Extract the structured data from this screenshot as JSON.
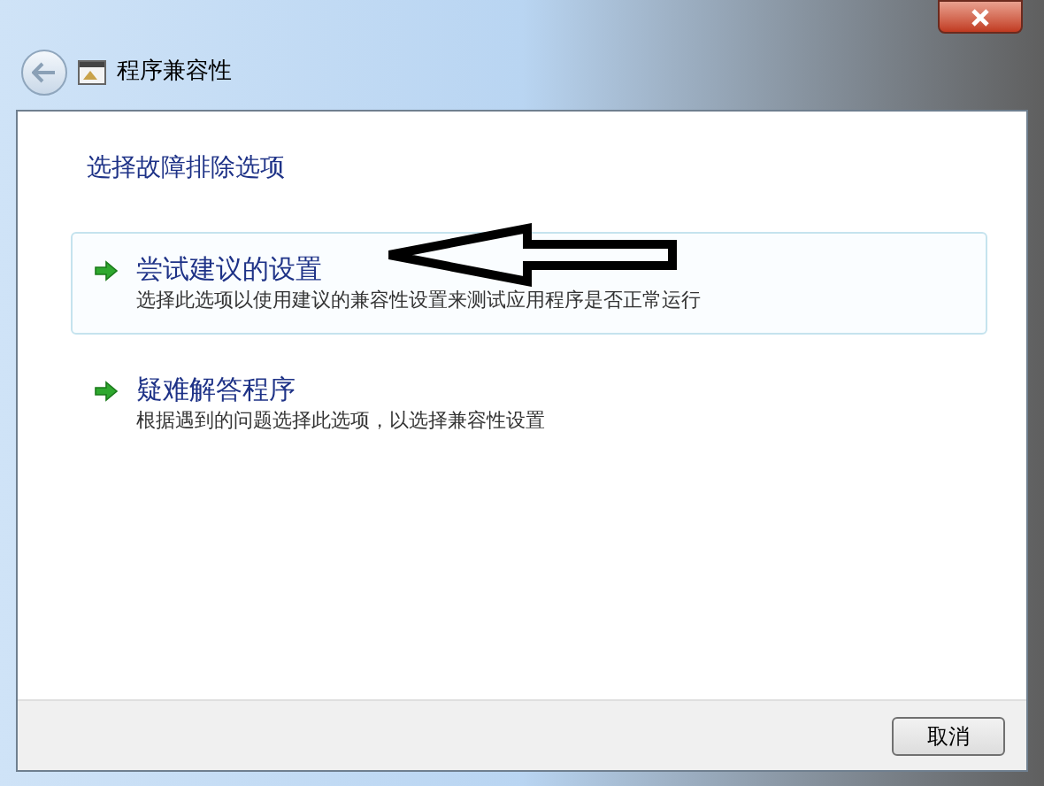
{
  "window": {
    "title": "程序兼容性"
  },
  "heading": "选择故障排除选项",
  "options": [
    {
      "title": "尝试建议的设置",
      "description": "选择此选项以使用建议的兼容性设置来测试应用程序是否正常运行",
      "selected": true
    },
    {
      "title": "疑难解答程序",
      "description": "根据遇到的问题选择此选项，以选择兼容性设置",
      "selected": false
    }
  ],
  "buttons": [
    "取消"
  ]
}
